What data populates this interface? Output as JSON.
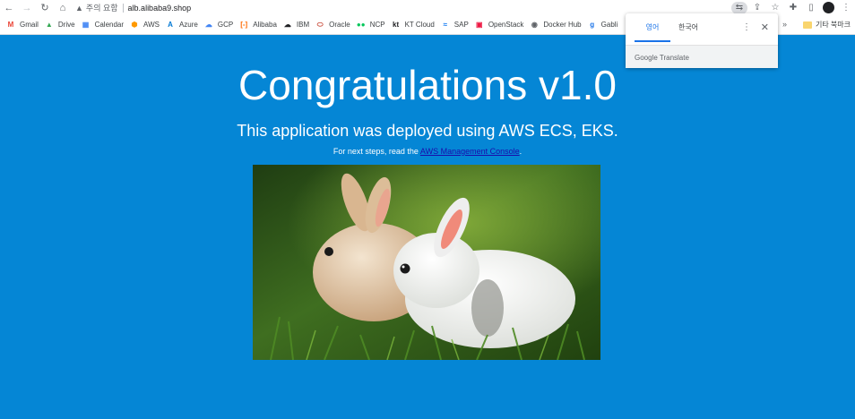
{
  "browser": {
    "security_label": "주의 요함",
    "url": "alb.alibaba9.shop"
  },
  "bookmarks": [
    {
      "label": "Gmail",
      "icon": "gmail-icon",
      "color": "#ea4335",
      "glyph": "M"
    },
    {
      "label": "Drive",
      "icon": "drive-icon",
      "color": "#34a853",
      "glyph": "▲"
    },
    {
      "label": "Calendar",
      "icon": "calendar-icon",
      "color": "#4285f4",
      "glyph": "▦"
    },
    {
      "label": "AWS",
      "icon": "aws-icon",
      "color": "#ff9900",
      "glyph": "⬢"
    },
    {
      "label": "Azure",
      "icon": "azure-icon",
      "color": "#0078d4",
      "glyph": "A"
    },
    {
      "label": "GCP",
      "icon": "gcp-icon",
      "color": "#4285f4",
      "glyph": "☁"
    },
    {
      "label": "Alibaba",
      "icon": "alibaba-icon",
      "color": "#ff6a00",
      "glyph": "[-]"
    },
    {
      "label": "IBM",
      "icon": "ibm-icon",
      "color": "#202124",
      "glyph": "☁"
    },
    {
      "label": "Oracle",
      "icon": "oracle-icon",
      "color": "#c74634",
      "glyph": "⬭"
    },
    {
      "label": "NCP",
      "icon": "ncp-icon",
      "color": "#03c75a",
      "glyph": "●●"
    },
    {
      "label": "KT Cloud",
      "icon": "kt-icon",
      "color": "#202124",
      "glyph": "kt"
    },
    {
      "label": "SAP",
      "icon": "sap-icon",
      "color": "#0070f2",
      "glyph": "≈"
    },
    {
      "label": "OpenStack",
      "icon": "openstack-icon",
      "color": "#ed1944",
      "glyph": "▣"
    },
    {
      "label": "Docker Hub",
      "icon": "docker-icon",
      "color": "#5f6368",
      "glyph": "◉"
    },
    {
      "label": "Gabli",
      "icon": "gabli-icon",
      "color": "#1a73e8",
      "glyph": "g"
    }
  ],
  "bookmarks_overflow": "»",
  "other_bookmarks_label": "기타 북마크",
  "page": {
    "headline": "Congratulations v1.0",
    "subline": "This application was deployed using AWS ECS, EKS.",
    "steps_prefix": "For next steps, read the ",
    "steps_link": "AWS Management Console",
    "steps_suffix": "."
  },
  "translate_popup": {
    "tabs": [
      "영어",
      "한국어"
    ],
    "active_tab": 0,
    "footer": "Google Translate"
  },
  "colors": {
    "page_background": "#0586d5",
    "link": "#1a0dab",
    "translate_accent": "#1a73e8"
  }
}
